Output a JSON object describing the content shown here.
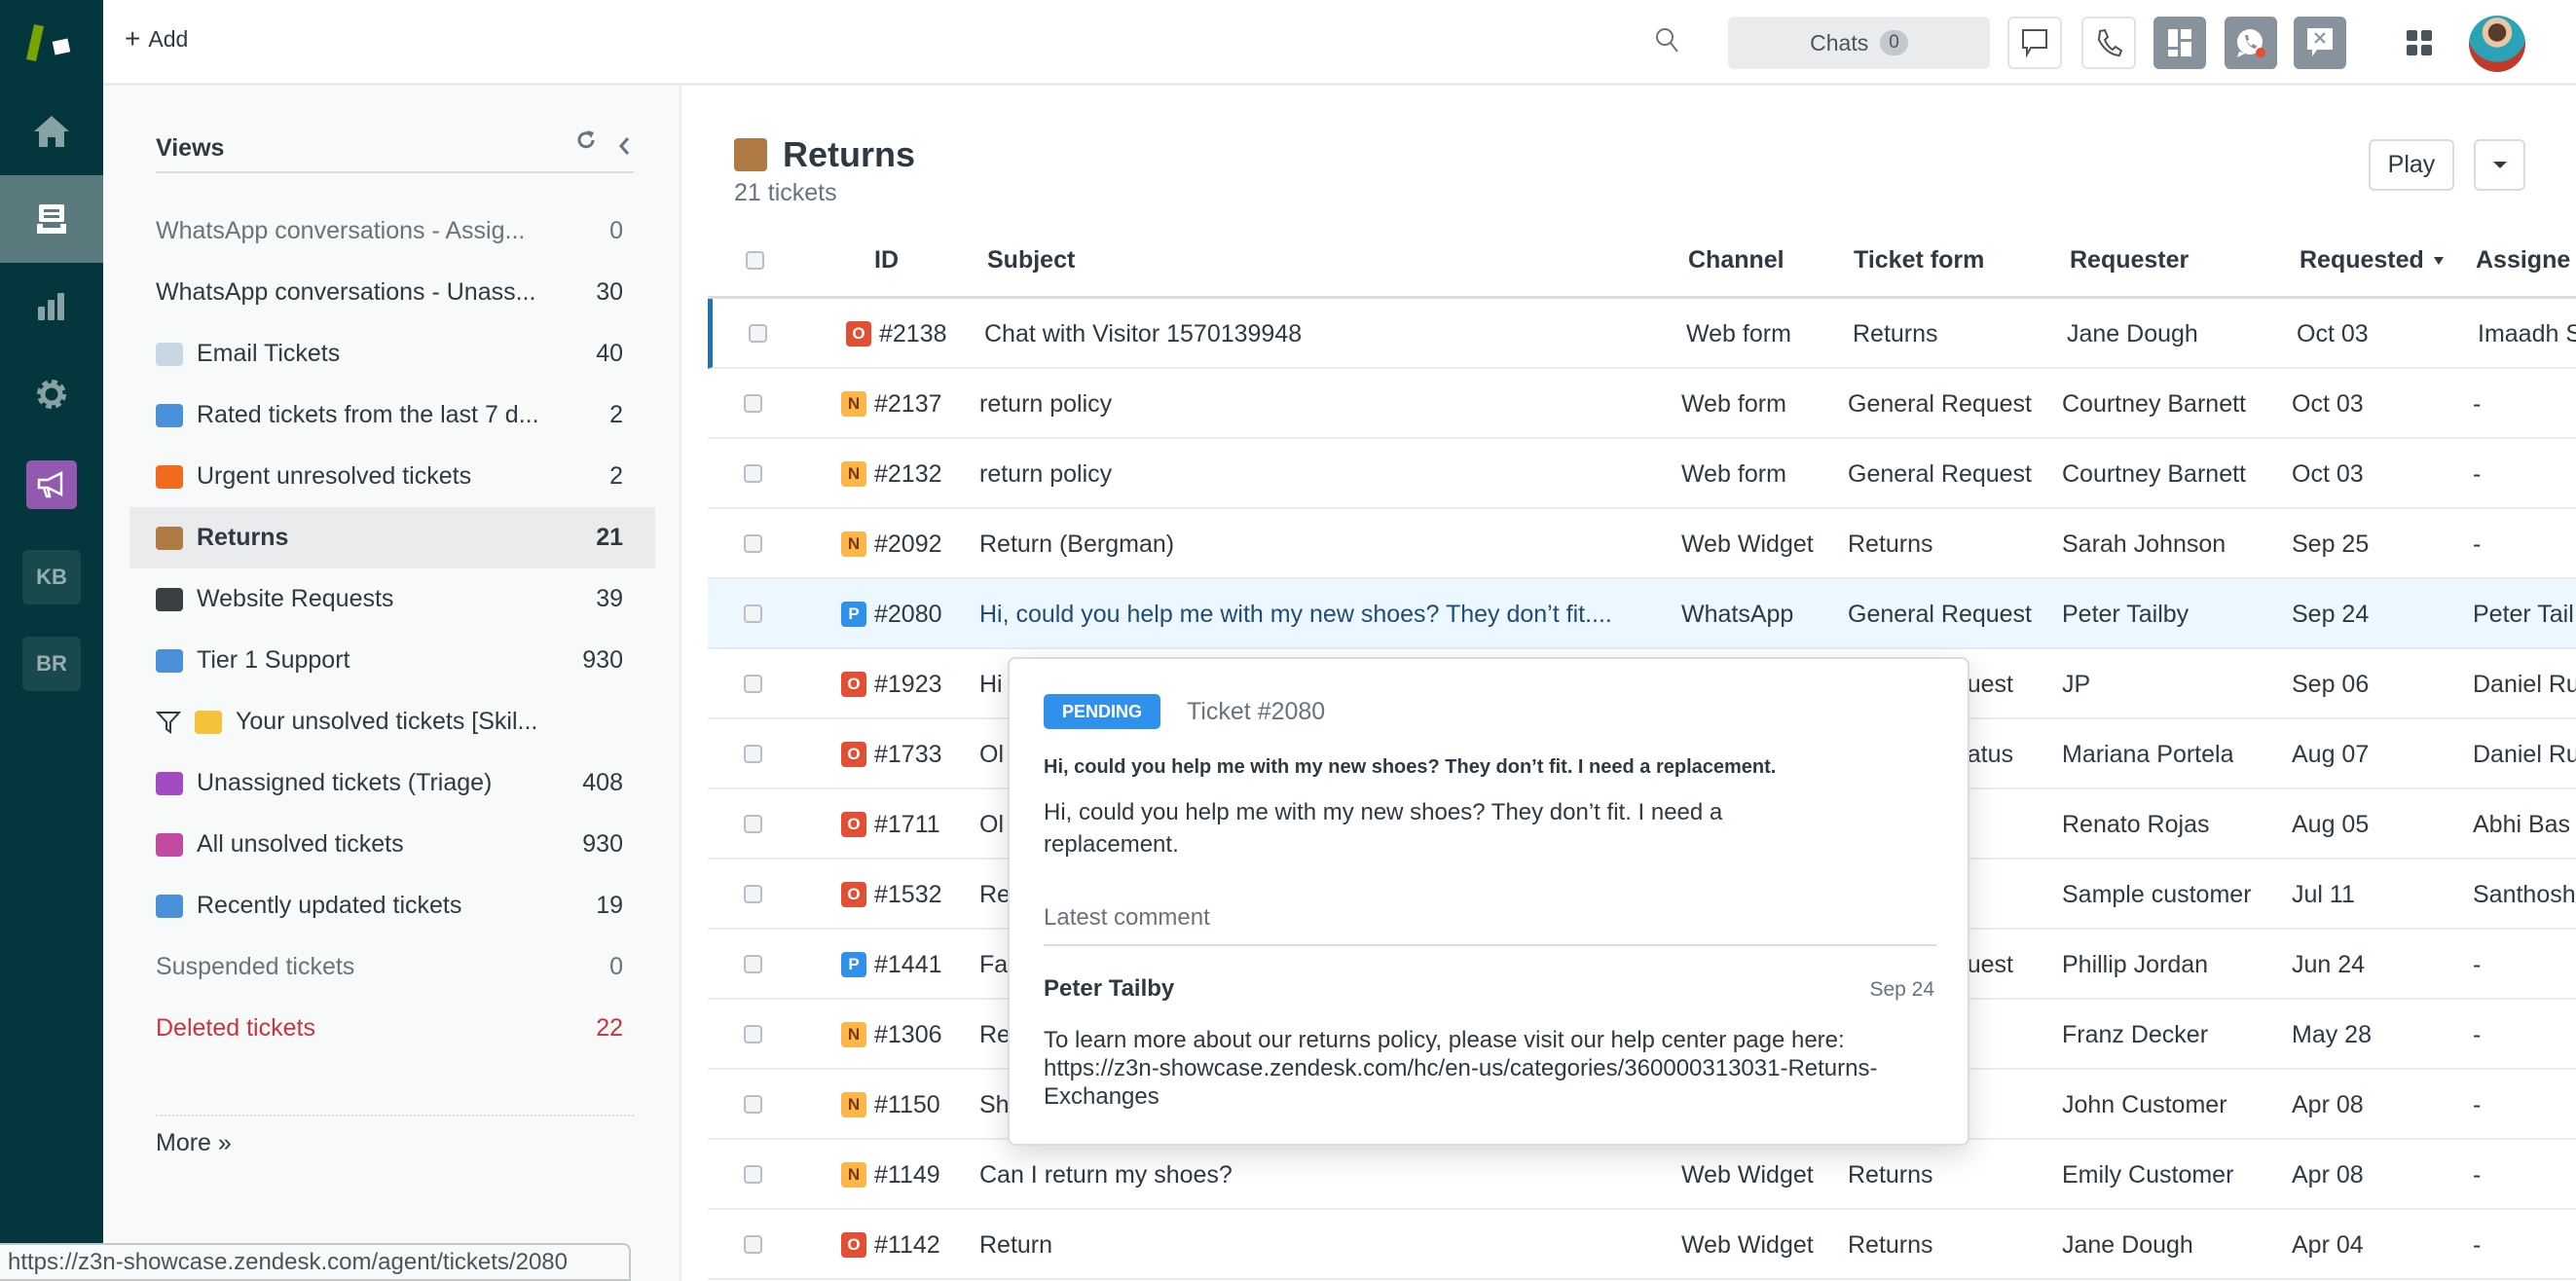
{
  "topbar": {
    "add_label": "Add",
    "chats_label": "Chats",
    "chats_count": "0"
  },
  "nav": {
    "items": [
      "home-icon",
      "views-icon",
      "reporting-icon",
      "admin-gear-icon",
      "megaphone-icon"
    ],
    "kb": "KB",
    "br": "BR"
  },
  "views": {
    "title": "Views",
    "items": [
      {
        "label": "WhatsApp conversations - Assig...",
        "count": "0",
        "icon": "",
        "muted": true
      },
      {
        "label": "WhatsApp conversations - Unass...",
        "count": "30",
        "icon": ""
      },
      {
        "label": "Email Tickets",
        "count": "40",
        "icon": "email-emoji",
        "color": "#c9d6e3"
      },
      {
        "label": "Rated tickets from the last 7 d...",
        "count": "2",
        "icon": "bar-chart-emoji",
        "color": "#4a90d9"
      },
      {
        "label": "Urgent unresolved tickets",
        "count": "2",
        "icon": "fire-emoji",
        "color": "#f26b1d"
      },
      {
        "label": "Returns",
        "count": "21",
        "icon": "package-emoji",
        "color": "#b07a45",
        "active": true
      },
      {
        "label": "Website Requests",
        "count": "39",
        "icon": "laptop-emoji",
        "color": "#3a3f44"
      },
      {
        "label": "Tier 1 Support",
        "count": "930",
        "icon": "keycap-1-emoji",
        "color": "#4a90d9"
      },
      {
        "label": "Your unsolved tickets [Skil...",
        "count": "",
        "icon": "pointing-up-emoji",
        "color": "#f5c33b",
        "filter": true
      },
      {
        "label": "Unassigned tickets (Triage)",
        "count": "408",
        "icon": "shrugging-emoji",
        "color": "#a34bc2"
      },
      {
        "label": "All unsolved tickets",
        "count": "930",
        "icon": "raising-hand-emoji",
        "color": "#c14ba3"
      },
      {
        "label": "Recently updated tickets",
        "count": "19",
        "icon": "new-emoji",
        "color": "#4a90d9"
      },
      {
        "label": "Suspended tickets",
        "count": "0",
        "icon": "",
        "muted": true
      },
      {
        "label": "Deleted tickets",
        "count": "22",
        "icon": "",
        "danger": true
      }
    ],
    "more": "More »"
  },
  "main": {
    "title": "Returns",
    "subtitle": "21 tickets",
    "play": "Play",
    "columns": {
      "id": "ID",
      "subject": "Subject",
      "channel": "Channel",
      "form": "Ticket form",
      "requester": "Requester",
      "requested": "Requested",
      "assignee": "Assigne"
    },
    "rows": [
      {
        "status": "O",
        "id": "#2138",
        "subject": "Chat with Visitor 1570139948",
        "channel": "Web form",
        "form": "Returns",
        "requester": "Jane Dough",
        "requested": "Oct 03",
        "assignee": "Imaadh S"
      },
      {
        "status": "N",
        "id": "#2137",
        "subject": "return policy",
        "channel": "Web form",
        "form": "General Request",
        "requester": "Courtney Barnett",
        "requested": "Oct 03",
        "assignee": "-"
      },
      {
        "status": "N",
        "id": "#2132",
        "subject": "return policy",
        "channel": "Web form",
        "form": "General Request",
        "requester": "Courtney Barnett",
        "requested": "Oct 03",
        "assignee": "-"
      },
      {
        "status": "N",
        "id": "#2092",
        "subject": "Return (Bergman)",
        "channel": "Web Widget",
        "form": "Returns",
        "requester": "Sarah Johnson",
        "requested": "Sep 25",
        "assignee": "-"
      },
      {
        "status": "P",
        "id": "#2080",
        "subject": "Hi, could you help me with my new shoes? They don’t fit....",
        "channel": "WhatsApp",
        "form": "General Request",
        "requester": "Peter Tailby",
        "requested": "Sep 24",
        "assignee": "Peter Tail"
      },
      {
        "status": "O",
        "id": "#1923",
        "subject": "Hi",
        "channel": "",
        "form": "quest",
        "requester": "JP",
        "requested": "Sep 06",
        "assignee": "Daniel Ru"
      },
      {
        "status": "O",
        "id": "#1733",
        "subject": "Ol",
        "channel": "",
        "form": "atus",
        "requester": "Mariana Portela",
        "requested": "Aug 07",
        "assignee": "Daniel Ru"
      },
      {
        "status": "O",
        "id": "#1711",
        "subject": "Ol",
        "channel": "",
        "form": "",
        "requester": "Renato Rojas",
        "requested": "Aug 05",
        "assignee": "Abhi Bas"
      },
      {
        "status": "O",
        "id": "#1532",
        "subject": "Re",
        "channel": "",
        "form": "",
        "requester": "Sample customer",
        "requested": "Jul 11",
        "assignee": "Santhosh"
      },
      {
        "status": "P",
        "id": "#1441",
        "subject": "Fa",
        "channel": "",
        "form": "quest",
        "requester": "Phillip Jordan",
        "requested": "Jun 24",
        "assignee": "-"
      },
      {
        "status": "N",
        "id": "#1306",
        "subject": "Re",
        "channel": "",
        "form": "",
        "requester": "Franz Decker",
        "requested": "May 28",
        "assignee": "-"
      },
      {
        "status": "N",
        "id": "#1150",
        "subject": "Sh",
        "channel": "",
        "form": "",
        "requester": "John Customer",
        "requested": "Apr 08",
        "assignee": "-"
      },
      {
        "status": "N",
        "id": "#1149",
        "subject": "Can I return my shoes?",
        "channel": "Web Widget",
        "form": "Returns",
        "requester": "Emily Customer",
        "requested": "Apr 08",
        "assignee": "-"
      },
      {
        "status": "O",
        "id": "#1142",
        "subject": "Return",
        "channel": "Web Widget",
        "form": "Returns",
        "requester": "Jane Dough",
        "requested": "Apr 04",
        "assignee": "-"
      }
    ]
  },
  "status_colors": {
    "O": "#e34f32",
    "N": "#ffb648",
    "P": "#3091ec"
  },
  "popover": {
    "badge": "PENDING",
    "ticket": "Ticket #2080",
    "subject": "Hi, could you help me with my new shoes? They don’t fit. I need a replacement.",
    "description": "Hi, could you help me with my new shoes? They don’t fit. I need a replacement.",
    "latest_label": "Latest comment",
    "author": "Peter Tailby",
    "date": "Sep 24",
    "comment": "To learn more about our returns policy, please visit our help center page here: https://z3n-showcase.zendesk.com/hc/en-us/categories/360000313031-Returns-Exchanges"
  },
  "statusbar": {
    "url": "https://z3n-showcase.zendesk.com/agent/tickets/2080"
  }
}
